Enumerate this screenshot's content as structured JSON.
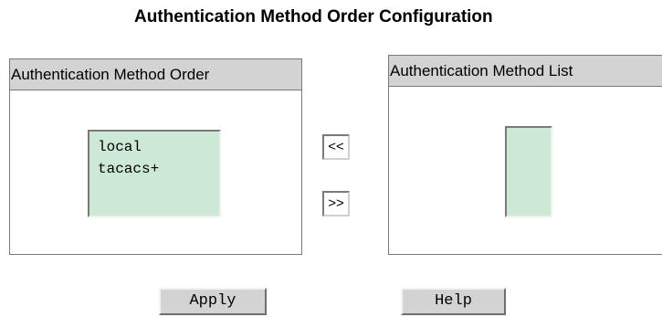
{
  "page": {
    "title": "Authentication Method Order Configuration"
  },
  "order_panel": {
    "header": "Authentication Method Order",
    "items": [
      "local",
      "tacacs+"
    ]
  },
  "list_panel": {
    "header": "Authentication Method List",
    "items": []
  },
  "controls": {
    "move_left_label": "<<",
    "move_right_label": ">>",
    "apply_label": "Apply",
    "help_label": "Help"
  },
  "colors": {
    "listbox_bg": "#cde8d4",
    "header_bg": "#d3d3d3",
    "button_bg": "#d3d3d3"
  }
}
